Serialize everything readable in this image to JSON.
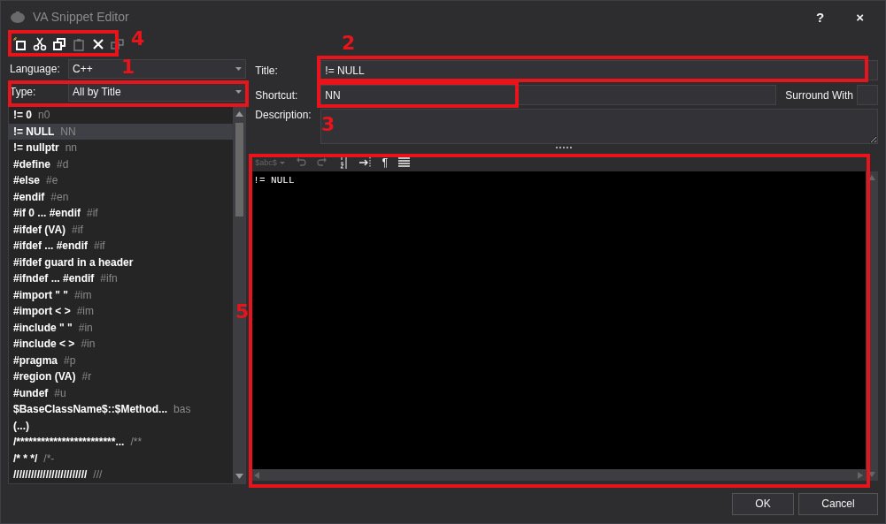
{
  "window": {
    "title": "VA Snippet Editor",
    "help": "?",
    "close": "×"
  },
  "toolbar": [
    {
      "kind": "new",
      "disabled": false
    },
    {
      "kind": "cut",
      "disabled": false
    },
    {
      "kind": "copy",
      "disabled": false
    },
    {
      "kind": "paste",
      "disabled": true
    },
    {
      "kind": "delete",
      "disabled": false
    },
    {
      "kind": "extra",
      "disabled": true
    }
  ],
  "language": {
    "label": "Language:",
    "value": "C++"
  },
  "type": {
    "label": "Type:",
    "value": "All by Title"
  },
  "snippets": [
    {
      "title": "!= 0",
      "shortcut": "n0",
      "selected": false
    },
    {
      "title": "!= NULL",
      "shortcut": "NN",
      "selected": true
    },
    {
      "title": "!= nullptr",
      "shortcut": "nn",
      "selected": false
    },
    {
      "title": "#define",
      "shortcut": "#d",
      "selected": false
    },
    {
      "title": "#else",
      "shortcut": "#e",
      "selected": false
    },
    {
      "title": "#endif",
      "shortcut": "#en",
      "selected": false
    },
    {
      "title": "#if 0 ... #endif",
      "shortcut": "#if",
      "selected": false
    },
    {
      "title": "#ifdef (VA)",
      "shortcut": "#if",
      "selected": false
    },
    {
      "title": "#ifdef ... #endif",
      "shortcut": "#if",
      "selected": false
    },
    {
      "title": "#ifdef guard in a header",
      "selected": false
    },
    {
      "title": "#ifndef ... #endif",
      "shortcut": "#ifn",
      "selected": false
    },
    {
      "title": "#import \" \"",
      "shortcut": "#im",
      "selected": false
    },
    {
      "title": "#import < >",
      "shortcut": "#im",
      "selected": false
    },
    {
      "title": "#include \" \"",
      "shortcut": "#in",
      "selected": false
    },
    {
      "title": "#include < >",
      "shortcut": "#in",
      "selected": false
    },
    {
      "title": "#pragma",
      "shortcut": "#p",
      "selected": false
    },
    {
      "title": "#region (VA)",
      "shortcut": "#r",
      "selected": false
    },
    {
      "title": "#undef",
      "shortcut": "#u",
      "selected": false
    },
    {
      "title": "$BaseClassName$::$Method...",
      "shortcut": "bas",
      "selected": false
    },
    {
      "title": "(...)",
      "selected": false
    },
    {
      "title": "/************************...",
      "shortcut": "/**",
      "selected": false
    },
    {
      "title": "/* *   */",
      "shortcut": "/*-",
      "selected": false
    },
    {
      "title": "/////////////////////////",
      "shortcut": "///",
      "selected": false
    }
  ],
  "title_field": {
    "label": "Title:",
    "value": "!= NULL"
  },
  "shortcut_field": {
    "label": "Shortcut:",
    "value": "NN"
  },
  "surround_with": {
    "label": "Surround With"
  },
  "description": {
    "label": "Description:"
  },
  "editor_toolbar": [
    {
      "kind": "variables",
      "text": "$abc$",
      "disabled": true
    },
    {
      "kind": "undo",
      "disabled": true
    },
    {
      "kind": "redo",
      "disabled": true
    },
    {
      "kind": "sort",
      "disabled": false
    },
    {
      "kind": "tab",
      "disabled": false
    },
    {
      "kind": "pilcrow",
      "text": "¶",
      "disabled": false
    },
    {
      "kind": "lines",
      "disabled": false
    }
  ],
  "editor": {
    "text": "!= NULL"
  },
  "buttons": [
    {
      "label": "OK"
    },
    {
      "label": "Cancel"
    }
  ],
  "annotations": [
    {
      "label": "4"
    },
    {
      "label": "1"
    },
    {
      "label": "2"
    },
    {
      "label": "3"
    },
    {
      "label": "5"
    }
  ]
}
